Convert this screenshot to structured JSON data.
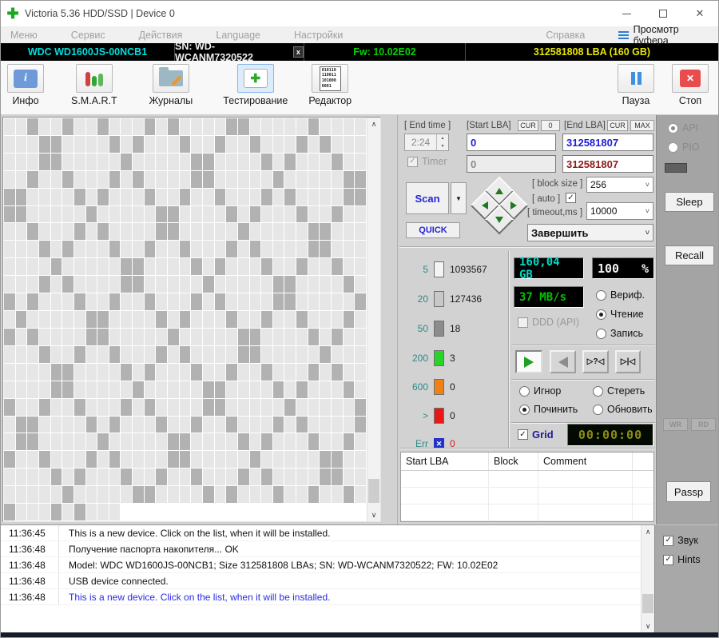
{
  "window": {
    "title": "Victoria 5.36 HDD/SSD | Device 0"
  },
  "icons": {
    "app_plus": "✚",
    "close_x": "✕",
    "err_x": "✕",
    "check": "✓",
    "chevron_down": "˅",
    "dropdown_arrow": "▼",
    "spin_up": "▲",
    "spin_down": "▼",
    "scroll_up": "∧",
    "scroll_down": "∨",
    "skip_question": "▷?◁",
    "skip_end": "▷|◁"
  },
  "menu": {
    "items": [
      "Меню",
      "Сервис",
      "Действия",
      "Language",
      "Настройки",
      "Справка"
    ],
    "buffer_view": "Просмотр буфера"
  },
  "device_bar": {
    "model": "WDC WD1600JS-00NCB1",
    "serial": "SN: WD-WCANM7320522",
    "close": "x",
    "firmware": "Fw: 10.02E02",
    "capacity": "312581808 LBA (160 GB)"
  },
  "toolbar": {
    "info": "Инфо",
    "smart": "S.M.A.R.T",
    "logs": "Журналы",
    "test": "Тестирование",
    "editor": "Редактор",
    "editor_icon_text": "010110\n110011\n101000\n0001",
    "pause": "Пауза",
    "stop": "Стоп"
  },
  "scan_grid": {
    "light": "#e6e6e6",
    "dark": "#b2b2b2",
    "rows": [
      "..x..x..x...x.x....xx.....x....",
      "...xx....x.x...x..x..x...x.x...",
      "...xx.....x.....xx....x.x...x..",
      "..x..x...x.x....xx.....x.....xx",
      "xx....x.x...x..x..x...x.x....xx",
      "xx.....x.....xx....x.x...x..x..",
      "..x...x.x....xx.....x.....xx...",
      "...x.x...x..x..x...x.x....xx...",
      "....x.....xx....x.x...x..x..x..",
      "...x.x....xx.....x.....xx....x.",
      "x.x...x..x..x...x.x....xx.....x",
      ".x.....xx....x.x...x..x..x...x.",
      "x.x....xx.....x.....xx....x.x..",
      "...x..x..x...x.x....xx.....x...",
      "....xx....x.x...x..x..x...x.x..",
      "....xx.....x.....xx....x.x...x.",
      "x..x..x...x.x....xx.....x.....x",
      ".xx....x.x...x..x..x...x.x....x",
      ".xx.....x.....xx....x.x...x..x.",
      "x..x...x.x....xx.....x.....xx..",
      "....x.x...x..x..x...x.x....xx..",
      ".....x.....xx....x.x...x..x..x.",
      "x...x.x..."
    ]
  },
  "test_settings": {
    "end_time_label": "[ End time ]",
    "end_time": "2:24",
    "start_lba_label": "[Start LBA]",
    "end_lba_label": "[End LBA]",
    "cur": "CUR",
    "zero": "0",
    "max": "MAX",
    "start_lba": "0",
    "end_lba": "312581807",
    "timer_label": "Timer",
    "timer_start": "0",
    "timer_end": "312581807",
    "scan": "Scan",
    "quick": "QUICK",
    "block_size_label": "[ block size ]",
    "block_size": "256",
    "auto_label": "[ auto ]",
    "timeout_label": "[ timeout,ms ]",
    "timeout": "10000",
    "finish_action": "Завершить"
  },
  "stats": {
    "rows": [
      {
        "label": "5",
        "count": "1093567",
        "color": "#f4f4f4",
        "err": false
      },
      {
        "label": "20",
        "count": "127436",
        "color": "#c8c8c8",
        "err": false
      },
      {
        "label": "50",
        "count": "18",
        "color": "#8c8c8c",
        "err": false
      },
      {
        "label": "200",
        "count": "3",
        "color": "#28d428",
        "err": false
      },
      {
        "label": "600",
        "count": "0",
        "color": "#f08018",
        "err": false
      },
      {
        "label": ">",
        "count": "0",
        "color": "#e81818",
        "err": false
      },
      {
        "label": "Err",
        "count": "0",
        "color": "#2233cc",
        "err": true
      }
    ]
  },
  "status": {
    "capacity_lcd": "160,04 GB",
    "percent": "100",
    "percent_unit": "%",
    "speed_lcd": "37 MB/s",
    "ddd": "DDD (API)",
    "modes": [
      "Вериф.",
      "Чтение",
      "Запись"
    ],
    "action_labels": [
      "Игнор",
      "Стереть",
      "Починить",
      "Обновить"
    ],
    "grid_label": "Grid",
    "grid_timer": "00:00:00"
  },
  "defect_table": {
    "headers": [
      "Start LBA",
      "Block",
      "Comment"
    ]
  },
  "sidebar": {
    "api": "API",
    "pio": "PIO",
    "sleep": "Sleep",
    "recall": "Recall",
    "wr": "WR",
    "rd": "RD",
    "passp": "Passp",
    "sound": "Звук",
    "hints": "Hints"
  },
  "log": {
    "entries": [
      {
        "time": "11:36:45",
        "text": "This is a new device. Click on the list, when it will be installed.",
        "color": "#111111"
      },
      {
        "time": "11:36:48",
        "text": "Получение паспорта накопителя... OK",
        "color": "#111111"
      },
      {
        "time": "11:36:48",
        "text": "Model: WDC WD1600JS-00NCB1; Size 312581808 LBAs; SN: WD-WCANM7320522; FW: 10.02E02",
        "color": "#111111"
      },
      {
        "time": "11:36:48",
        "text": "USB device connected.",
        "color": "#111111"
      },
      {
        "time": "11:36:48",
        "text": "This is a new device. Click on the list, when it will be installed.",
        "color": "#2a2ae6"
      }
    ]
  }
}
